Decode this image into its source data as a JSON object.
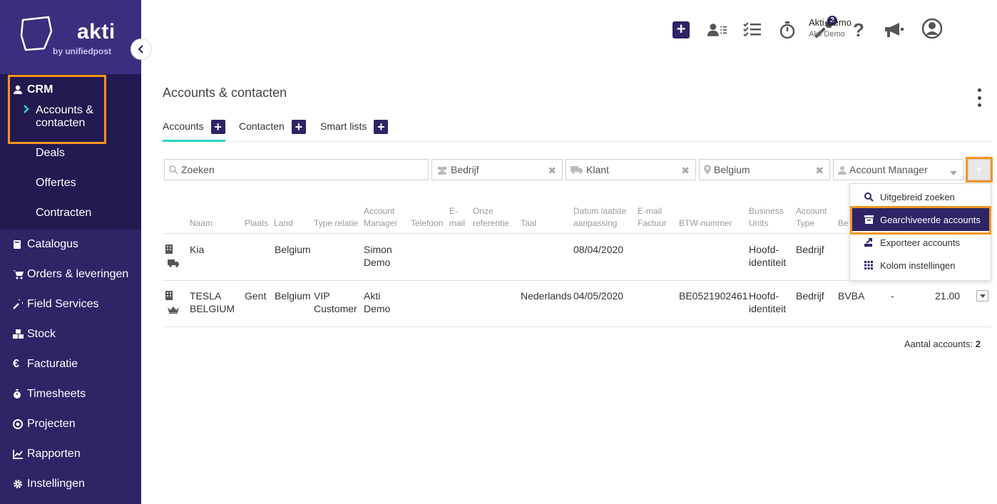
{
  "brand": {
    "name": "akti",
    "sub": "by unifiedpost"
  },
  "user": {
    "name": "Akti Demo",
    "company": "Akti Demo"
  },
  "topbar": {
    "notifications_badge": "2"
  },
  "sidebar": {
    "crm_label": "CRM",
    "crm_items": [
      {
        "label": "Accounts & contacten",
        "active": true
      },
      {
        "label": "Deals"
      },
      {
        "label": "Offertes"
      },
      {
        "label": "Contracten"
      }
    ],
    "items": [
      {
        "label": "Catalogus",
        "icon": "book-icon"
      },
      {
        "label": "Orders & leveringen",
        "icon": "cart-icon"
      },
      {
        "label": "Field Services",
        "icon": "wrench-icon"
      },
      {
        "label": "Stock",
        "icon": "boxes-icon"
      },
      {
        "label": "Facturatie",
        "icon": "euro-icon"
      },
      {
        "label": "Timesheets",
        "icon": "stopwatch-icon"
      },
      {
        "label": "Projecten",
        "icon": "target-icon"
      },
      {
        "label": "Rapporten",
        "icon": "chart-icon"
      },
      {
        "label": "Instellingen",
        "icon": "gear-icon"
      }
    ]
  },
  "page": {
    "title": "Accounts & contacten",
    "tabs": [
      {
        "label": "Accounts"
      },
      {
        "label": "Contacten"
      },
      {
        "label": "Smart lists"
      }
    ]
  },
  "filters": {
    "search_placeholder": "Zoeken",
    "company": "Bedrijf",
    "relation": "Klant",
    "country": "Belgium",
    "account_manager": "Account Manager"
  },
  "table": {
    "headers": {
      "naam": "Naam",
      "plaats": "Plaats",
      "land": "Land",
      "type_relatie": "Type relatie",
      "account_manager_1": "Account",
      "account_manager_2": "Manager",
      "telefoon": "Telefoon",
      "email_1": "E-",
      "email_2": "mail",
      "referentie_1": "Onze",
      "referentie_2": "referentie",
      "taal": "Taal",
      "datum_1": "Datum laatste",
      "datum_2": "aanpassing",
      "email_factuur_1": "E-mail",
      "email_factuur_2": "Factuur",
      "btw": "BTW-nummer",
      "bu_1": "Business",
      "bu_2": "Units",
      "account_type_1": "Account",
      "account_type_2": "Type",
      "bedrijf_partial": "Be"
    },
    "rows": [
      {
        "naam_1": "Kia",
        "naam_2": "",
        "plaats": "",
        "land": "Belgium",
        "type_1": "",
        "type_2": "",
        "manager_1": "Simon",
        "manager_2": "Demo",
        "taal": "",
        "datum": "08/04/2020",
        "btw": "",
        "bu_1": "Hoofd-",
        "bu_2": "identiteit",
        "account_type": "Bedrijf",
        "vorm": "",
        "dash": "",
        "amount": ""
      },
      {
        "naam_1": "TESLA",
        "naam_2": "BELGIUM",
        "plaats": "Gent",
        "land": "Belgium",
        "type_1": "VIP",
        "type_2": "Customer",
        "manager_1": "Akti",
        "manager_2": "Demo",
        "taal": "Nederlands",
        "datum": "04/05/2020",
        "btw": "BE0521902461",
        "bu_1": "Hoofd-",
        "bu_2": "identiteit",
        "account_type": "Bedrijf",
        "vorm": "BVBA",
        "dash": "-",
        "amount": "21.00"
      }
    ],
    "count_label": "Aantal accounts:",
    "count_value": "2"
  },
  "menu": {
    "items": [
      {
        "label": "Uitgebreid zoeken",
        "icon": "search-icon"
      },
      {
        "label": "Gearchiveerde accounts",
        "icon": "archive-icon",
        "selected": true
      },
      {
        "label": "Exporteer accounts",
        "icon": "export-icon"
      },
      {
        "label": "Kolom instellingen",
        "icon": "grid-icon"
      }
    ]
  },
  "colors": {
    "primary": "#2e2466",
    "accent": "#27d3c3",
    "highlight": "#f7941d"
  }
}
